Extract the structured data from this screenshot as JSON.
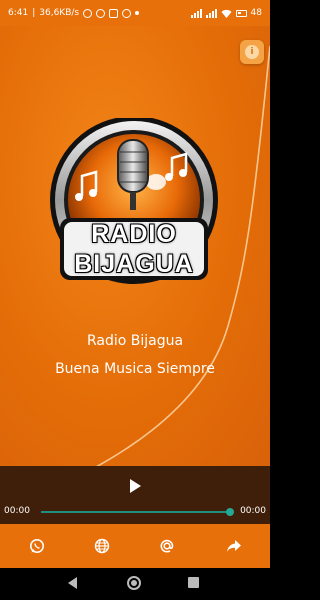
{
  "status_bar": {
    "time": "6:41",
    "network_speed": "36,6KB/s",
    "battery": "48"
  },
  "station": {
    "logo_line1": "RADIO",
    "logo_line2": "BIJAGUA",
    "name": "Radio Bijagua",
    "slogan": "Buena Musica Siempre"
  },
  "player": {
    "current_time": "00:00",
    "total_time": "00:00",
    "progress": 0.99
  },
  "toolbar": {
    "icons": [
      "whatsapp-icon",
      "globe-icon",
      "at-icon",
      "share-icon"
    ]
  },
  "colors": {
    "accent": "#e8700a",
    "player_bg": "#3f1e0a",
    "seek": "#26a896"
  }
}
